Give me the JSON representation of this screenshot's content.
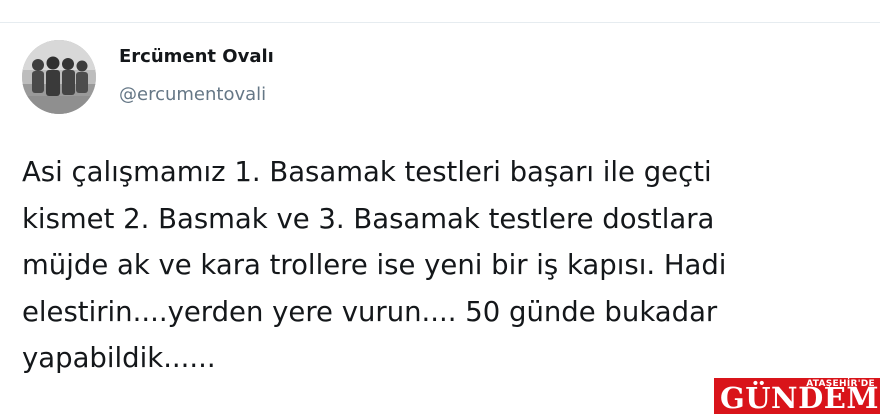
{
  "tweet": {
    "author": {
      "display_name": "Ercüment Ovalı",
      "handle": "@ercumentovali"
    },
    "text_lines": [
      "Asi çalışmamız 1. Basamak testleri başarı ile  geçti",
      "kismet 2. Basmak ve 3. Basamak testlere  dostlara",
      "müjde ak ve kara trollere ise yeni bir iş kapısı. Hadi",
      "elestirin....yerden yere vurun.... 50 günde bukadar",
      "yapabildik......"
    ]
  },
  "watermark": {
    "top_text": "ATAŞEHİR'DE",
    "main_text": "GÜNDEM"
  },
  "colors": {
    "text": "#14171a",
    "handle": "#657786",
    "divider": "#e6ecf0",
    "watermark_bg": "#d9141a",
    "watermark_text": "#ffffff"
  }
}
